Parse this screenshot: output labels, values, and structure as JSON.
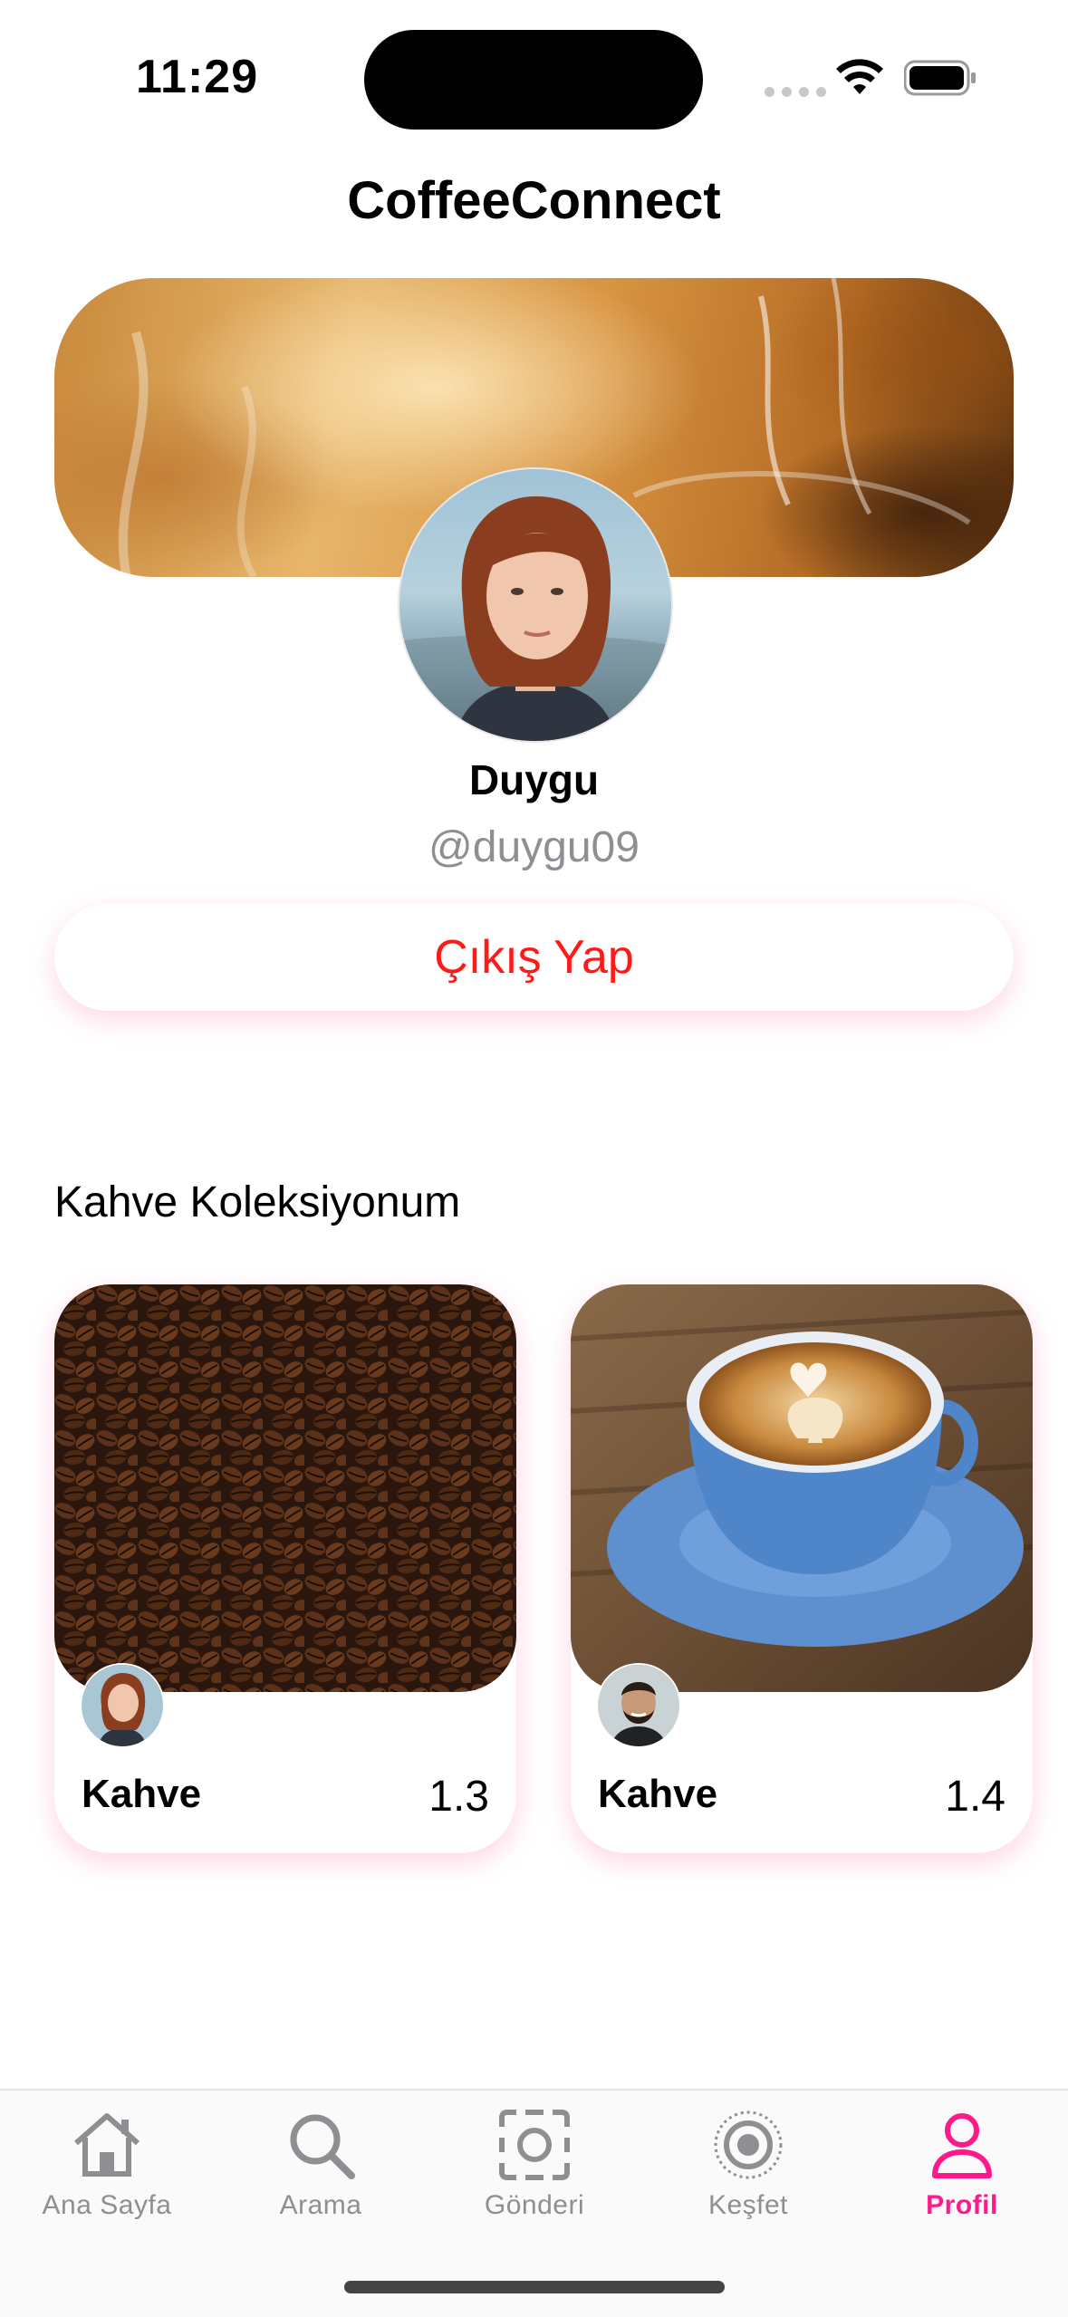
{
  "status_bar": {
    "time": "11:29"
  },
  "app": {
    "title": "CoffeeConnect"
  },
  "profile": {
    "name": "Duygu",
    "handle": "@duygu09",
    "logout_label": "Çıkış Yap"
  },
  "collection": {
    "title": "Kahve Koleksiyonum",
    "items": [
      {
        "title": "Kahve",
        "rating": "1.3",
        "image": "coffee-beans"
      },
      {
        "title": "Kahve",
        "rating": "1.4",
        "image": "latte-cup"
      }
    ]
  },
  "tab_bar": {
    "tabs": [
      {
        "label": "Ana Sayfa",
        "icon": "house-icon"
      },
      {
        "label": "Arama",
        "icon": "magnifier-icon"
      },
      {
        "label": "Gönderi",
        "icon": "camera-frame-icon"
      },
      {
        "label": "Keşfet",
        "icon": "target-icon"
      },
      {
        "label": "Profil",
        "icon": "person-icon"
      }
    ],
    "active": "Profil"
  },
  "colors": {
    "accent": "#ff1a8c",
    "logout": "#ff1a1a",
    "inactive": "#8e8e93"
  }
}
